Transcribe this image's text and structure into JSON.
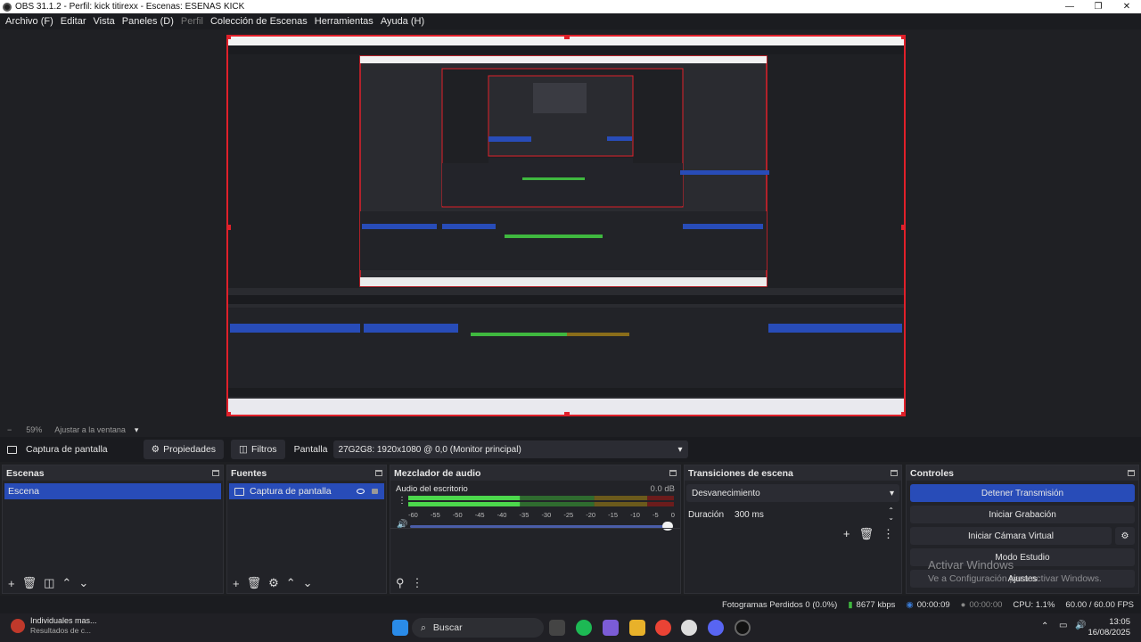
{
  "window": {
    "title": "OBS 31.1.2 - Perfil: kick titirexx - Escenas: ESENAS KICK",
    "min_icon": "minimize-icon",
    "max_icon": "maximize-icon",
    "close_icon": "close-icon",
    "min_glyph": "—",
    "max_glyph": "❐",
    "close_glyph": "✕"
  },
  "menu": [
    "Archivo (F)",
    "Editar",
    "Vista",
    "Paneles (D)",
    "Perfil",
    "Colección de Escenas",
    "Herramientas",
    "Ayuda (H)"
  ],
  "zoom": {
    "minus": "−",
    "level": "59%",
    "fit": "Ajustar a la ventana",
    "caret": "▾"
  },
  "source_toolbar": {
    "source_name": "Captura de pantalla",
    "properties": "Propiedades",
    "filters": "Filtros",
    "display_label": "Pantalla",
    "display_value": "27G2G8: 1920x1080 @ 0,0 (Monitor principal)"
  },
  "scenes": {
    "title": "Escenas",
    "items": [
      "Escena"
    ]
  },
  "sources": {
    "title": "Fuentes",
    "items": [
      "Captura de pantalla"
    ]
  },
  "mixer": {
    "title": "Mezclador de audio",
    "channel": "Audio del escritorio",
    "db": "0.0 dB",
    "ticks": [
      "-60",
      "-55",
      "-50",
      "-45",
      "-40",
      "-35",
      "-30",
      "-25",
      "-20",
      "-15",
      "-10",
      "-5",
      "0"
    ],
    "volume": 1.0,
    "level": 0.42
  },
  "transitions": {
    "title": "Transiciones de escena",
    "type": "Desvanecimiento",
    "duration_label": "Duración",
    "duration_value": "300 ms"
  },
  "controls": {
    "title": "Controles",
    "stop_stream": "Detener Transmisión",
    "start_recording": "Iniciar Grabación",
    "start_vcam": "Iniciar Cámara Virtual",
    "studio_mode": "Modo Estudio",
    "settings": "Ajustes"
  },
  "watermark": {
    "line1": "Activar Windows",
    "line2": "Ve a Configuración para activar Windows."
  },
  "status": {
    "dropped": "Fotogramas Perdidos 0 (0.0%)",
    "bitrate": "8677 kbps",
    "live_time": "00:00:09",
    "rec_time": "00:00:00",
    "cpu": "CPU: 1.1%",
    "fps": "60.00 / 60.00 FPS"
  },
  "taskbar": {
    "notif_title": "Individuales mas...",
    "notif_sub": "Resultados de c...",
    "search": "Buscar",
    "time": "13:05",
    "date": "16/08/2025"
  },
  "colors": {
    "accent": "#284cb8",
    "selection_red": "#e0202a"
  }
}
